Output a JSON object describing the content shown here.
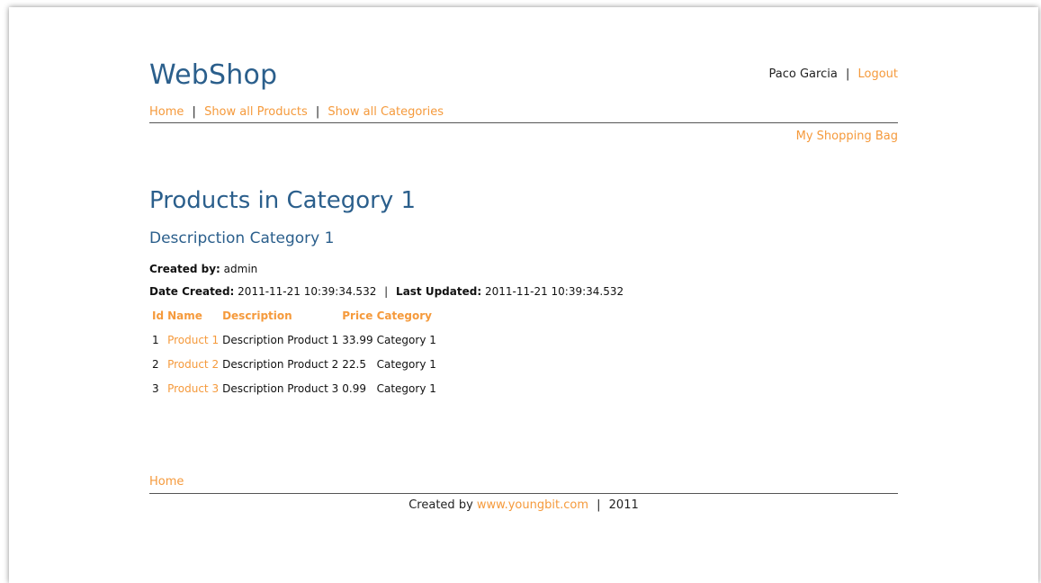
{
  "header": {
    "brand": "WebShop",
    "user_name": "Paco Garcia",
    "separator": "|",
    "logout_label": "Logout"
  },
  "nav": {
    "home": "Home",
    "show_all_products": "Show all Products",
    "show_all_categories": "Show all Categories",
    "separator": "|",
    "shopping_bag": "My Shopping Bag"
  },
  "main": {
    "title": "Products in Category 1",
    "subtitle": "Descripction Category 1",
    "created_by_label": "Created by:",
    "created_by_value": "admin",
    "date_created_label": "Date Created:",
    "date_created_value": "2011-11-21 10:39:34.532",
    "meta_separator": "|",
    "last_updated_label": "Last Updated:",
    "last_updated_value": "2011-11-21 10:39:34.532"
  },
  "table": {
    "headers": [
      "Id",
      "Name",
      "Description",
      "Price",
      "Category"
    ],
    "rows": [
      {
        "id": "1",
        "name": "Product 1",
        "description": "Description Product 1",
        "price": "33.99",
        "category": "Category 1"
      },
      {
        "id": "2",
        "name": "Product 2",
        "description": "Description Product 2",
        "price": "22.5",
        "category": "Category 1"
      },
      {
        "id": "3",
        "name": "Product 3",
        "description": "Description Product 3",
        "price": "0.99",
        "category": "Category 1"
      }
    ]
  },
  "footer": {
    "home": "Home",
    "created_by_text": "Created by",
    "site_link": "www.youngbit.com",
    "separator": "|",
    "year": "2011"
  },
  "colors": {
    "heading_blue": "#2b5f8c",
    "link_orange": "#f59a3c",
    "rule_gray": "#555555"
  }
}
